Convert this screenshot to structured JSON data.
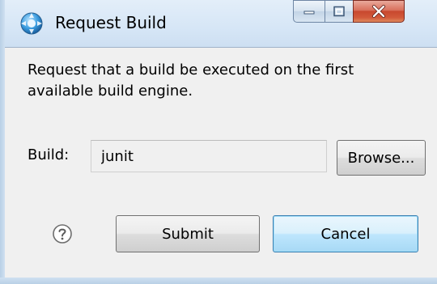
{
  "window": {
    "title": "Request Build",
    "icon": "build-globe-icon",
    "caption_buttons": {
      "minimize": "minimize-icon",
      "maximize": "maximize-icon",
      "close": "close-icon"
    }
  },
  "dialog": {
    "description": "Request that a build be executed on the first available build engine.",
    "build_label": "Build:",
    "build_value": "junit",
    "browse_label": "Browse...",
    "submit_label": "Submit",
    "cancel_label": "Cancel",
    "help_icon": "help-icon"
  },
  "colors": {
    "titlebar": "#d6e6f6",
    "client_bg": "#f0f0f0",
    "close_button": "#c8482f",
    "default_button_border": "#3c7fb1"
  }
}
